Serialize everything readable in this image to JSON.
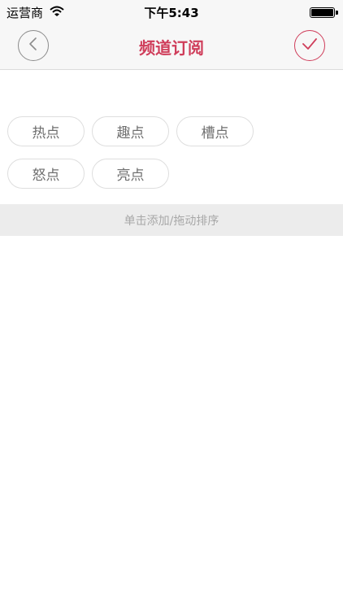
{
  "status_bar": {
    "carrier": "运营商",
    "time": "下午5:43"
  },
  "nav": {
    "title": "频道订阅"
  },
  "channels": [
    {
      "label": "热点"
    },
    {
      "label": "趣点"
    },
    {
      "label": "槽点"
    },
    {
      "label": "怒点"
    },
    {
      "label": "亮点"
    }
  ],
  "hint": {
    "text": "单击添加/拖动排序"
  },
  "colors": {
    "accent": "#cf3d5a",
    "chip_text": "#6f6f6f",
    "hint_bg": "#ececec"
  },
  "icons": {
    "back": "chevron-left-icon",
    "confirm": "checkmark-icon",
    "wifi": "wifi-icon",
    "battery": "battery-icon"
  }
}
